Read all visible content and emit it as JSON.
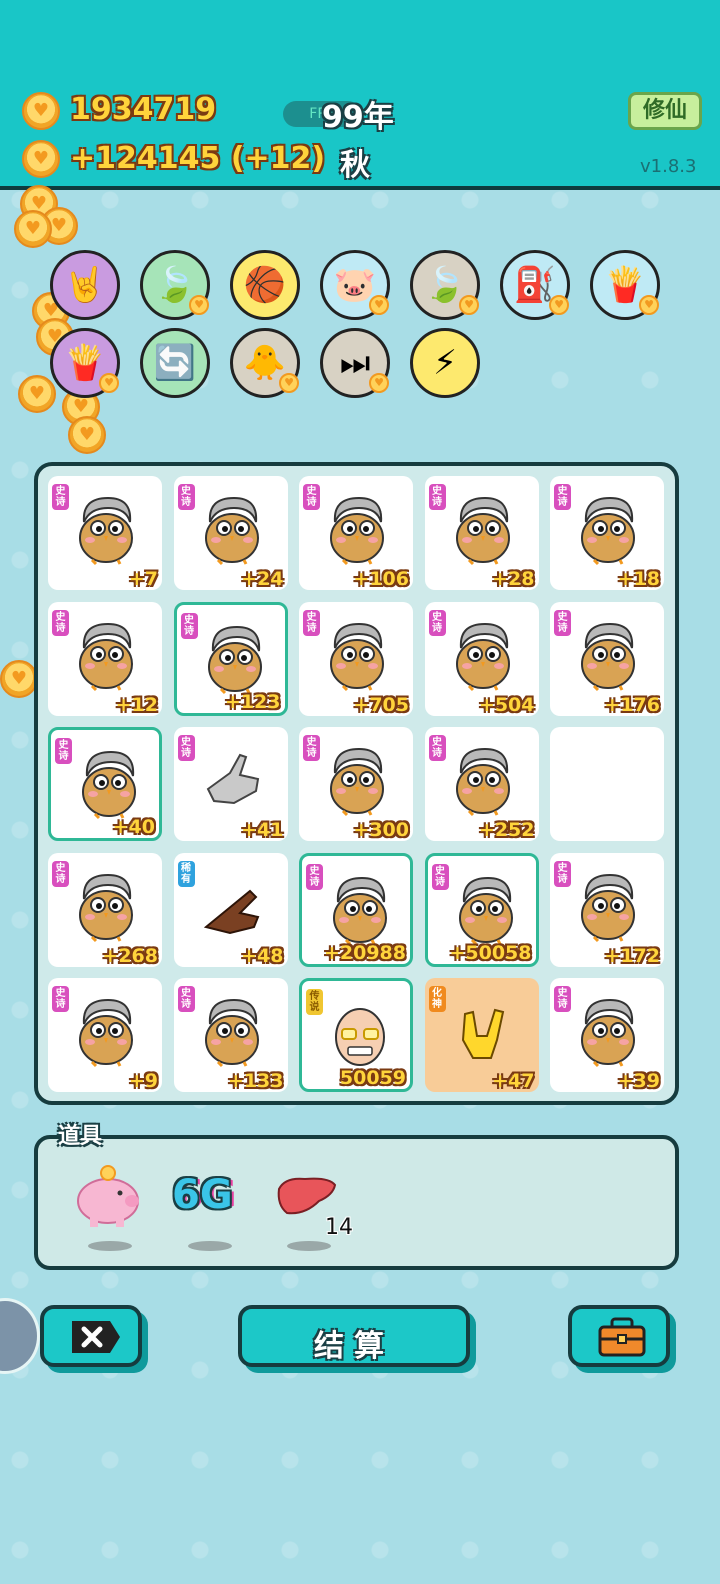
{
  "header": {
    "coins_total": "1934719",
    "coins_rate": "+124145 (+12)",
    "fps_label": "FPS",
    "year": "99年",
    "season": "秋",
    "mode_button": "修仙",
    "version": "v1.8.3"
  },
  "skills": [
    {
      "icon": "rock-hand-icon",
      "glyph": "🤘",
      "bg": "#c99be0"
    },
    {
      "icon": "leaf-icon",
      "glyph": "🍃",
      "bg": "#a6e4b8"
    },
    {
      "icon": "basketballs-icon",
      "glyph": "🏀",
      "bg": "#fde96e"
    },
    {
      "icon": "piggy-bank-icon",
      "glyph": "🐷",
      "bg": "#bfeaf5"
    },
    {
      "icon": "leaf-icon",
      "glyph": "🍃",
      "bg": "#d8d2c4"
    },
    {
      "icon": "air-pump-icon",
      "glyph": "⛽",
      "bg": "#bfeaf5"
    },
    {
      "icon": "fries-icon",
      "glyph": "🍟",
      "bg": "#bfeaf5"
    },
    {
      "icon": "fries-icon",
      "glyph": "🍟",
      "bg": "#c99be0"
    },
    {
      "icon": "refresh-icon",
      "glyph": "🔄",
      "bg": "#a6e4b8"
    },
    {
      "icon": "chick-egg-icon",
      "glyph": "🐥",
      "bg": "#d8d2c4"
    },
    {
      "icon": "skip-icon",
      "glyph": "⏭",
      "bg": "#d8d2c4"
    },
    {
      "icon": "lightning-icon",
      "glyph": "⚡",
      "bg": "#fde96e"
    }
  ],
  "grid": [
    [
      {
        "tag": "史诗",
        "kind": "epic",
        "value": "+7",
        "sprite": "chick-grandpa"
      },
      {
        "tag": "史诗",
        "kind": "epic",
        "value": "+24",
        "sprite": "chick-grandpa"
      },
      {
        "tag": "史诗",
        "kind": "epic",
        "value": "+106",
        "sprite": "chick-grandpa"
      },
      {
        "tag": "史诗",
        "kind": "epic",
        "value": "+28",
        "sprite": "chick-grandpa"
      },
      {
        "tag": "史诗",
        "kind": "epic",
        "value": "+18",
        "sprite": "chick-grandpa"
      }
    ],
    [
      {
        "tag": "史诗",
        "kind": "epic",
        "value": "+12",
        "sprite": "chick-grandpa"
      },
      {
        "tag": "史诗",
        "kind": "epic",
        "value": "+123",
        "sprite": "chick-grandpa",
        "selected": true
      },
      {
        "tag": "史诗",
        "kind": "epic",
        "value": "+705",
        "sprite": "chick-grandpa"
      },
      {
        "tag": "史诗",
        "kind": "epic",
        "value": "+504",
        "sprite": "chick-grandpa"
      },
      {
        "tag": "史诗",
        "kind": "epic",
        "value": "+176",
        "sprite": "chick-grandpa"
      }
    ],
    [
      {
        "tag": "史诗",
        "kind": "epic",
        "value": "+40",
        "sprite": "chick-grandpa",
        "selected": true
      },
      {
        "tag": "史诗",
        "kind": "epic",
        "value": "+41",
        "sprite": "grey-hand"
      },
      {
        "tag": "史诗",
        "kind": "epic",
        "value": "+300",
        "sprite": "chick-grandpa"
      },
      {
        "tag": "史诗",
        "kind": "epic",
        "value": "+252",
        "sprite": "chick-grandpa"
      },
      {
        "tag": "",
        "kind": "empty",
        "value": "",
        "sprite": "none"
      }
    ],
    [
      {
        "tag": "史诗",
        "kind": "epic",
        "value": "+268",
        "sprite": "chick-grandpa"
      },
      {
        "tag": "稀有",
        "kind": "rare",
        "value": "+48",
        "sprite": "brown-hand"
      },
      {
        "tag": "史诗",
        "kind": "epic",
        "value": "+20988",
        "sprite": "chick-grandpa",
        "selected": true
      },
      {
        "tag": "史诗",
        "kind": "epic",
        "value": "+50058",
        "sprite": "chick-grandpa",
        "selected": true
      },
      {
        "tag": "史诗",
        "kind": "epic",
        "value": "+172",
        "sprite": "chick-grandpa"
      }
    ],
    [
      {
        "tag": "史诗",
        "kind": "epic",
        "value": "+9",
        "sprite": "chick-grandpa"
      },
      {
        "tag": "史诗",
        "kind": "epic",
        "value": "+133",
        "sprite": "chick-grandpa"
      },
      {
        "tag": "传说",
        "kind": "legend",
        "value": "50059",
        "sprite": "bald-man",
        "selected": true
      },
      {
        "tag": "化神",
        "kind": "huashen",
        "value": "+47",
        "sprite": "yellow-hand",
        "orange": true
      },
      {
        "tag": "史诗",
        "kind": "epic",
        "value": "+39",
        "sprite": "chick-grandpa"
      }
    ]
  ],
  "items": {
    "title": "道具",
    "list": [
      {
        "icon": "piggy-bank-icon",
        "label": ""
      },
      {
        "icon": "6g-icon",
        "label": "6G"
      },
      {
        "icon": "liver-icon",
        "label": "",
        "count": "14"
      }
    ]
  },
  "buttons": {
    "exit_icon": "close-icon",
    "settle_label": "结算",
    "bag_icon": "briefcase-icon"
  }
}
